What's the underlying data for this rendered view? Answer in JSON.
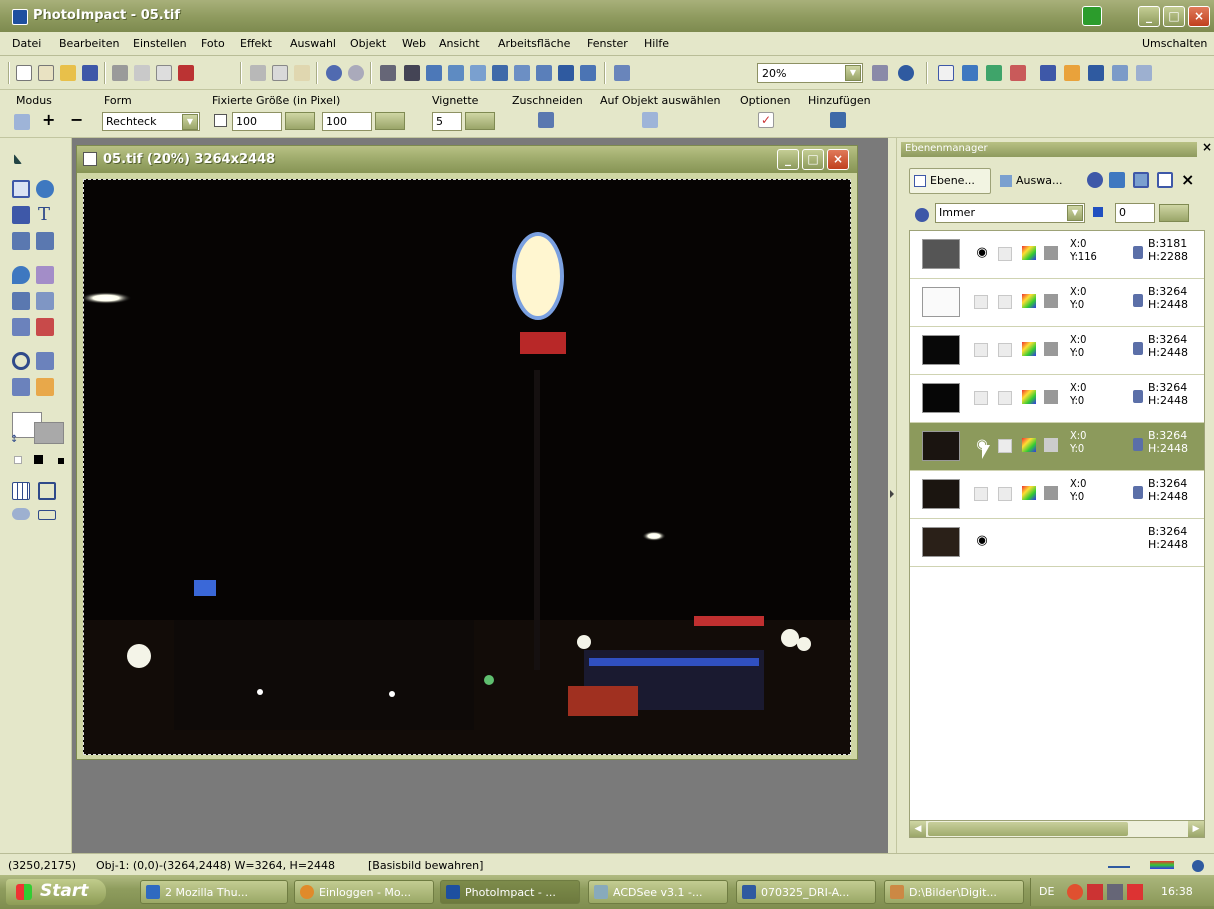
{
  "app": {
    "title": "PhotoImpact - 05.tif"
  },
  "menu": {
    "items": [
      "Datei",
      "Bearbeiten",
      "Einstellen",
      "Foto",
      "Effekt",
      "Auswahl",
      "Objekt",
      "Web",
      "Ansicht",
      "Arbeitsfläche",
      "Fenster",
      "Hilfe"
    ],
    "right": "Umschalten"
  },
  "toolbar": {
    "zoom": "20%"
  },
  "attributes": {
    "modus_label": "Modus",
    "form_label": "Form",
    "form_value": "Rechteck",
    "fixed_label": "Fixierte Größe (in Pixel)",
    "width_value": "100",
    "height_value": "100",
    "vignette_label": "Vignette",
    "vignette_value": "5",
    "crop_label": "Zuschneiden",
    "select_obj_label": "Auf Objekt auswählen",
    "options_label": "Optionen",
    "add_label": "Hinzufügen"
  },
  "document": {
    "title": "05.tif (20%) 3264x2448"
  },
  "layer_manager": {
    "title": "Ebenenmanager",
    "tab_layers": "Ebene...",
    "tab_select": "Auswa...",
    "mode": "Immer",
    "opacity": "0",
    "layers": [
      {
        "x": "X:0",
        "y": "Y:116",
        "w": "B:3181",
        "h": "H:2288",
        "visible": true
      },
      {
        "x": "X:0",
        "y": "Y:0",
        "w": "B:3264",
        "h": "H:2448",
        "visible": false
      },
      {
        "x": "X:0",
        "y": "Y:0",
        "w": "B:3264",
        "h": "H:2448",
        "visible": false
      },
      {
        "x": "X:0",
        "y": "Y:0",
        "w": "B:3264",
        "h": "H:2448",
        "visible": false
      },
      {
        "x": "X:0",
        "y": "Y:0",
        "w": "B:3264",
        "h": "H:2448",
        "visible": true
      },
      {
        "x": "X:0",
        "y": "Y:0",
        "w": "B:3264",
        "h": "H:2448",
        "visible": false
      },
      {
        "x": "",
        "y": "",
        "w": "B:3264",
        "h": "H:2448",
        "visible": true
      }
    ]
  },
  "status": {
    "coords": "(3250,2175)",
    "obj": "Obj-1: (0,0)-(3264,2448) W=3264, H=2448",
    "mode": "[Basisbild bewahren]"
  },
  "taskbar": {
    "start": "Start",
    "tasks": [
      "2 Mozilla Thu...",
      "Einloggen - Mo...",
      "PhotoImpact - ...",
      "ACDSee v3.1 -...",
      "070325_DRI-A...",
      "D:\\Bilder\\Digit..."
    ],
    "lang": "DE",
    "clock": "16:38"
  }
}
